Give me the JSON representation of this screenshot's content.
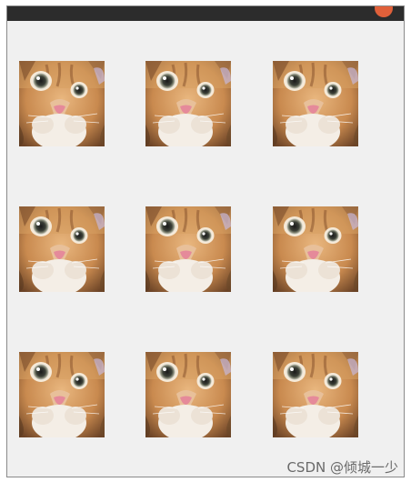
{
  "window": {
    "title": "",
    "close_color": "#e0603a"
  },
  "grid": {
    "rows": 3,
    "columns": 3,
    "cells": [
      {
        "image": "cat-photo"
      },
      {
        "image": "cat-photo"
      },
      {
        "image": "cat-photo"
      },
      {
        "image": "cat-photo"
      },
      {
        "image": "cat-photo"
      },
      {
        "image": "cat-photo"
      },
      {
        "image": "cat-photo"
      },
      {
        "image": "cat-photo"
      },
      {
        "image": "cat-photo"
      }
    ]
  },
  "watermark": "CSDN @倾城一少"
}
